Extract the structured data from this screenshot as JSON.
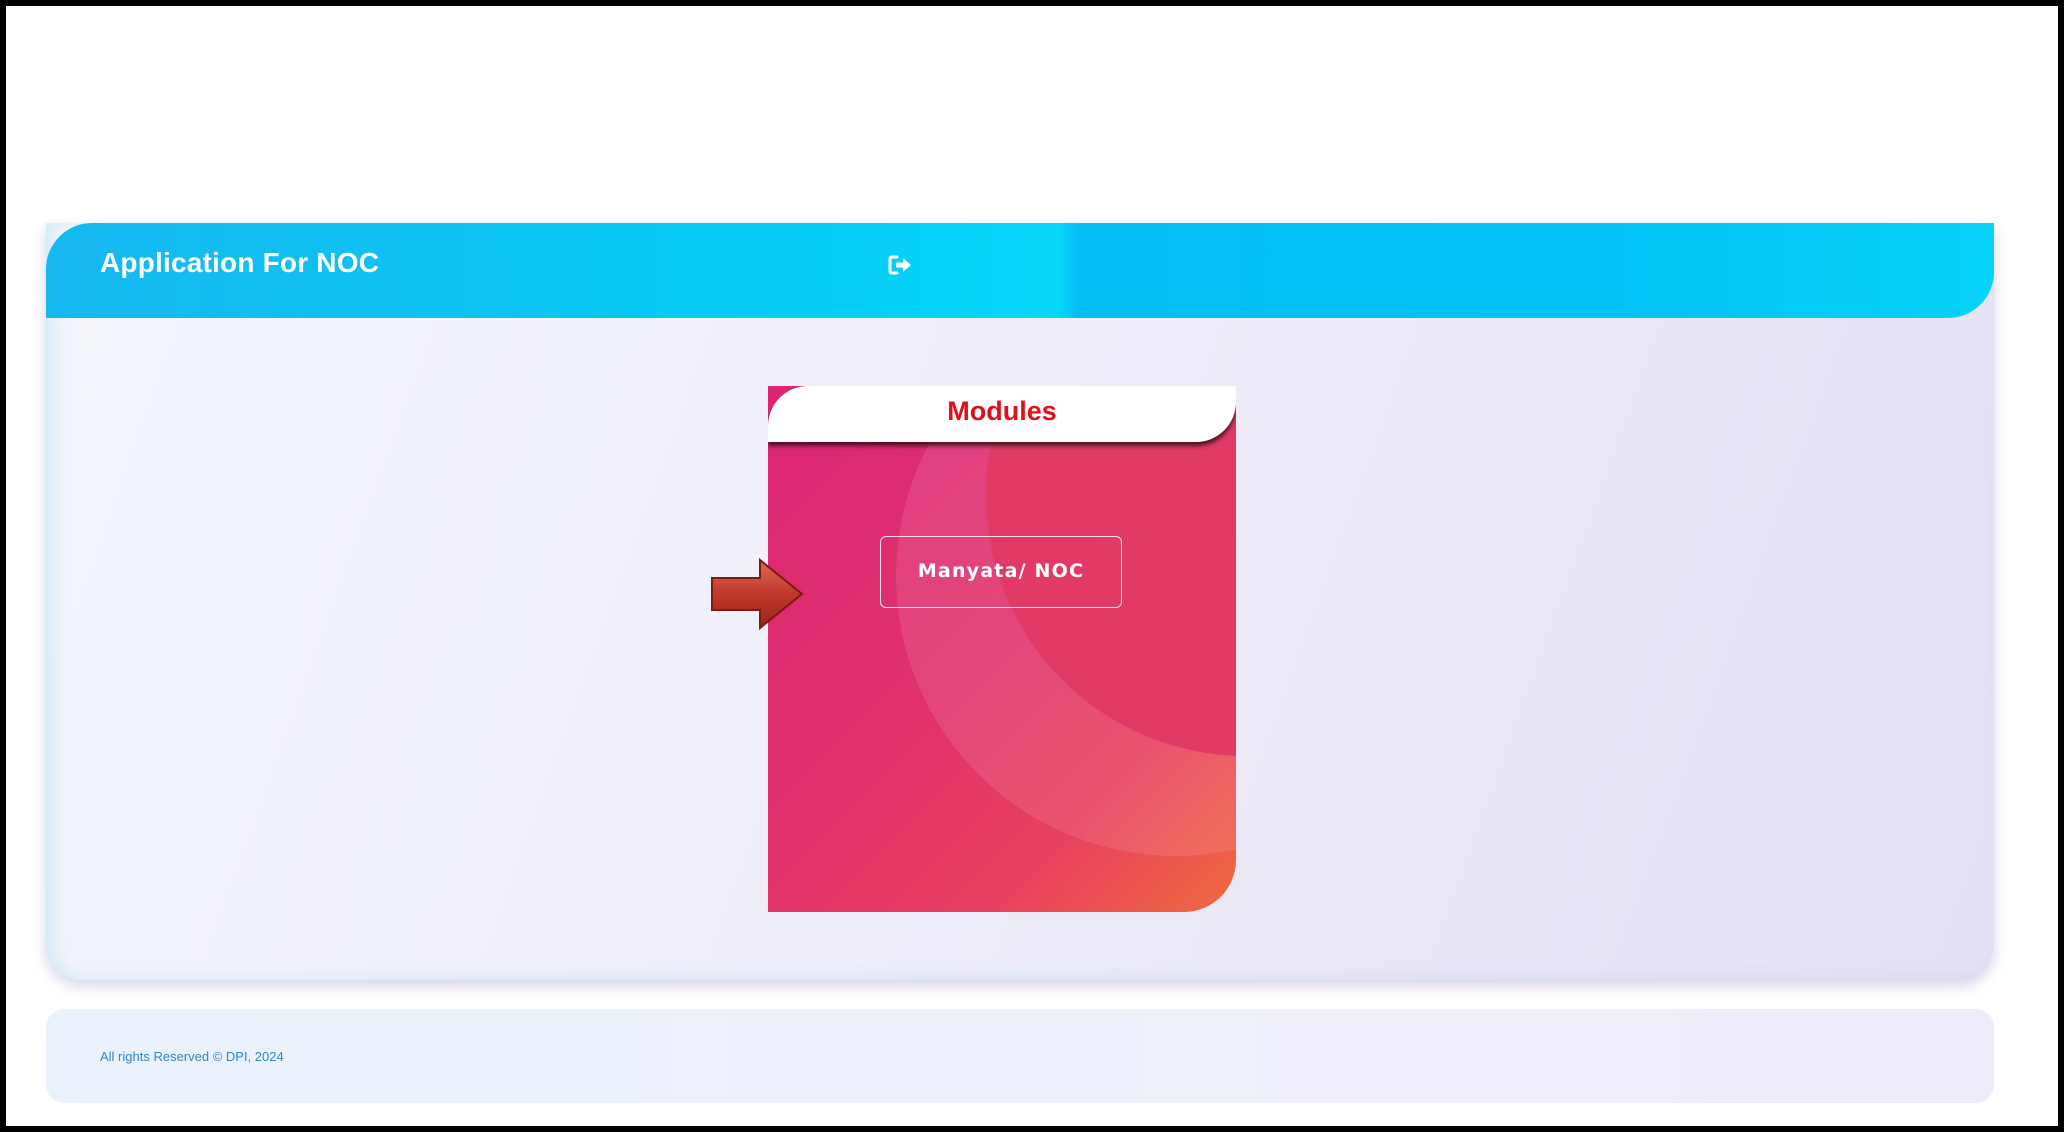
{
  "header": {
    "title": "Application For NOC",
    "logout_icon": "sign-out-icon"
  },
  "modules_card": {
    "title": "Modules",
    "button_label": "Manyata/ NOC",
    "pointer_icon": "red-arrow-right-icon"
  },
  "footer": {
    "copyright": "All rights Reserved © DPI, 2024"
  },
  "colors": {
    "header_accent": "#06cdf6",
    "card_gradient_start": "#dc2672",
    "card_gradient_end": "#f06a40",
    "card_title": "#e0101a",
    "footer_text": "#2d86c8"
  }
}
